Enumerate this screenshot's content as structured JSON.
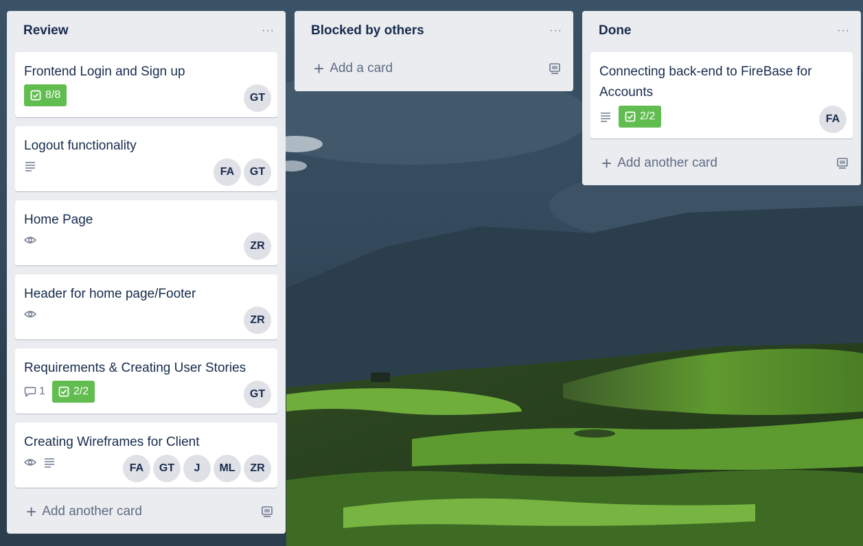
{
  "colors": {
    "list_bg": "#ebecf0",
    "checklist_complete": "#61bd4f",
    "avatar_bg": "#dfe1e6"
  },
  "lists": [
    {
      "title": "Review",
      "menu": "···",
      "cards": [
        {
          "title": "Frontend Login and Sign up",
          "checklist": "8/8",
          "members": [
            "GT"
          ]
        },
        {
          "title": "Logout functionality",
          "has_description": true,
          "members": [
            "FA",
            "GT"
          ]
        },
        {
          "title": "Home Page",
          "watching": true,
          "members": [
            "ZR"
          ]
        },
        {
          "title": "Header for home page/Footer",
          "watching": true,
          "members": [
            "ZR"
          ]
        },
        {
          "title": "Requirements & Creating User Stories",
          "comments": "1",
          "checklist": "2/2",
          "members": [
            "GT"
          ]
        },
        {
          "title": "Creating Wireframes for Client",
          "watching": true,
          "has_description": true,
          "members": [
            "FA",
            "GT",
            "J",
            "ML",
            "ZR"
          ]
        }
      ],
      "add_label": "Add another card"
    },
    {
      "title": "Blocked by others",
      "menu": "···",
      "cards": [],
      "add_label": "Add a card"
    },
    {
      "title": "Done",
      "menu": "···",
      "cards": [
        {
          "title": "Connecting back-end to FireBase for Accounts",
          "has_description": true,
          "checklist": "2/2",
          "members": [
            "FA"
          ]
        }
      ],
      "add_label": "Add another card"
    }
  ]
}
